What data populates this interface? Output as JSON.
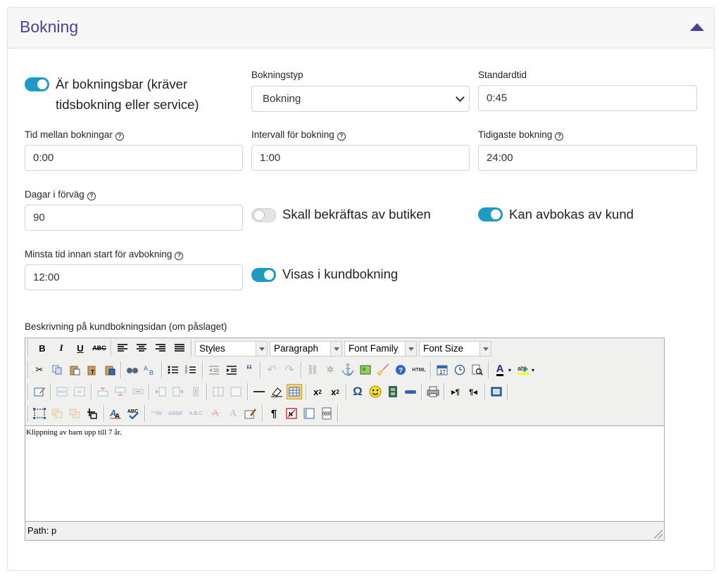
{
  "header": {
    "title": "Bokning"
  },
  "bookable": {
    "label": "Är bokningsbar (kräver",
    "label2": "tidsbokning eller service)",
    "on": true
  },
  "booking_type": {
    "label": "Bokningstyp",
    "value": "Bokning"
  },
  "standard_time": {
    "label": "Standardtid",
    "value": "0:45"
  },
  "time_between": {
    "label": "Tid mellan bokningar",
    "value": "0:00"
  },
  "interval": {
    "label": "Intervall för bokning",
    "value": "1:00"
  },
  "earliest": {
    "label": "Tidigaste bokning",
    "value": "24:00"
  },
  "days_ahead": {
    "label": "Dagar i förväg",
    "value": "90"
  },
  "confirm_by_shop": {
    "label": "Skall bekräftas av butiken",
    "on": false
  },
  "cancel_by_customer": {
    "label": "Kan avbokas av kund",
    "on": true
  },
  "min_time_cancel": {
    "label": "Minsta tid innan start för avbokning",
    "value": "12:00"
  },
  "show_in_booking": {
    "label": "Visas i kundbokning",
    "on": true
  },
  "description": {
    "label": "Beskrivning på kundbokningsidan (om påslaget)",
    "content": "Klippning av barn upp till 7 år.",
    "path": "Path: p",
    "toolbar": {
      "styles": "Styles",
      "format": "Paragraph",
      "font_family": "Font Family",
      "font_size": "Font Size",
      "bold": "B",
      "italic": "I",
      "underline": "U",
      "strike": "ABC"
    }
  },
  "colors": {
    "accent": "#1d9bc6",
    "title": "#4a3fa0"
  }
}
